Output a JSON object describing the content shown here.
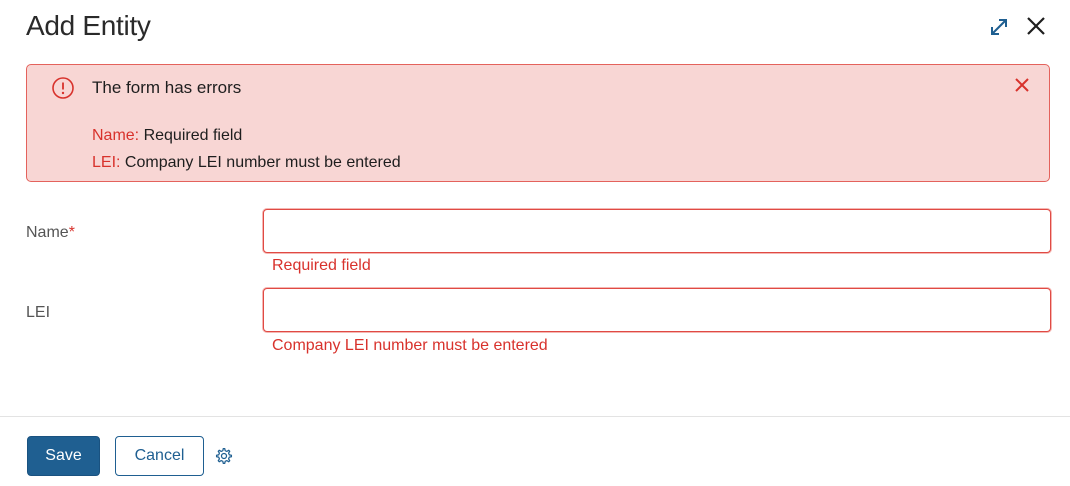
{
  "dialog": {
    "title": "Add Entity",
    "icons": {
      "expand": "expand-arrows-icon",
      "close": "close-icon"
    }
  },
  "error_banner": {
    "title": "The form has errors",
    "icon": "alert-circle-icon",
    "close_icon": "close-icon",
    "errors": [
      {
        "field": "Name:",
        "message": "Required field"
      },
      {
        "field": "LEI:",
        "message": "Company LEI number must be entered"
      }
    ]
  },
  "form": {
    "fields": [
      {
        "label": "Name",
        "required_marker": "*",
        "value": "",
        "placeholder": "",
        "error": "Required field"
      },
      {
        "label": "LEI",
        "required_marker": "",
        "value": "",
        "placeholder": "",
        "error": "Company LEI number must be entered"
      }
    ]
  },
  "footer": {
    "save_label": "Save",
    "cancel_label": "Cancel",
    "settings_icon": "gear-icon"
  },
  "colors": {
    "primary": "#1f5f91",
    "error": "#d8322c",
    "banner_background": "#f8d6d4",
    "banner_border": "#e4625c"
  }
}
